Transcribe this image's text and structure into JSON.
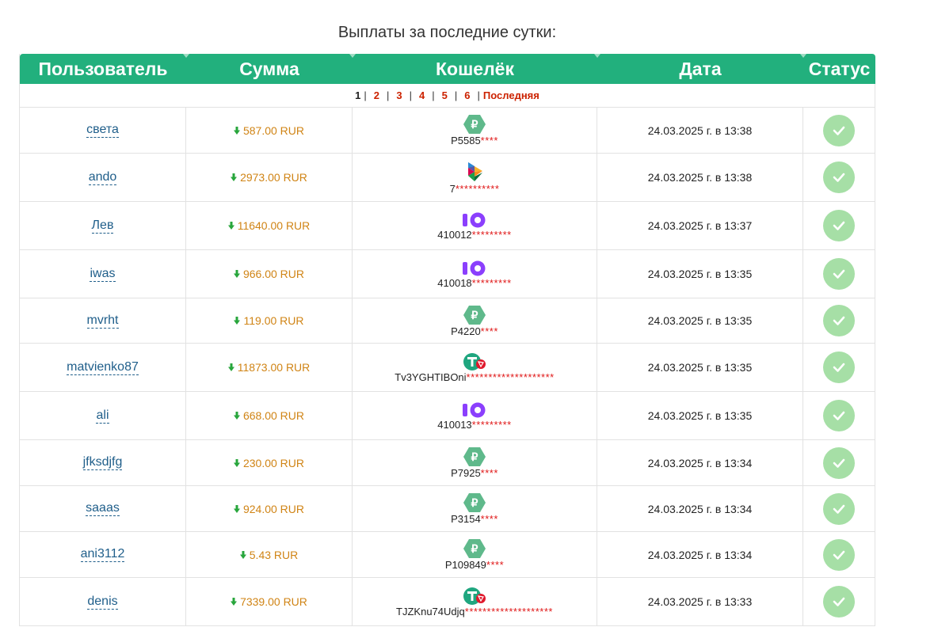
{
  "title": "Выплаты за последние сутки:",
  "headers": [
    "Пользователь",
    "Сумма",
    "Кошелёк",
    "Дата",
    "Статус"
  ],
  "pager": {
    "current": "1",
    "pages": [
      "2",
      "3",
      "4",
      "5",
      "6"
    ],
    "last": "Последняя"
  },
  "currency_colors": {
    "payeer": "#5fb98b",
    "yoomoney": "#8b3ffd",
    "usdt": "#1fa67f"
  },
  "rows": [
    {
      "user": "света",
      "amount": "587.00 RUR",
      "wallet_icon": "payeer-icon",
      "wallet_prefix": "P5585",
      "wallet_mask": "****",
      "date": "24.03.2025 г. в 13:38"
    },
    {
      "user": "ando",
      "amount": "2973.00 RUR",
      "wallet_icon": "sbp-icon",
      "wallet_prefix": "7",
      "wallet_mask": "**********",
      "date": "24.03.2025 г. в 13:38"
    },
    {
      "user": "Лев",
      "amount": "11640.00 RUR",
      "wallet_icon": "yoomoney-icon",
      "wallet_prefix": "410012",
      "wallet_mask": "*********",
      "date": "24.03.2025 г. в 13:37"
    },
    {
      "user": "iwas",
      "amount": "966.00 RUR",
      "wallet_icon": "yoomoney-icon",
      "wallet_prefix": "410018",
      "wallet_mask": "*********",
      "date": "24.03.2025 г. в 13:35"
    },
    {
      "user": "mvrht",
      "amount": "119.00 RUR",
      "wallet_icon": "payeer-icon",
      "wallet_prefix": "P4220",
      "wallet_mask": "****",
      "date": "24.03.2025 г. в 13:35"
    },
    {
      "user": "matvienko87",
      "amount": "11873.00 RUR",
      "wallet_icon": "usdt-trc20-icon",
      "wallet_prefix": "Tv3YGHTIBOni",
      "wallet_mask": "********************",
      "date": "24.03.2025 г. в 13:35"
    },
    {
      "user": "ali",
      "amount": "668.00 RUR",
      "wallet_icon": "yoomoney-icon",
      "wallet_prefix": "410013",
      "wallet_mask": "*********",
      "date": "24.03.2025 г. в 13:35"
    },
    {
      "user": "jfksdjfg",
      "amount": "230.00 RUR",
      "wallet_icon": "payeer-icon",
      "wallet_prefix": "P7925",
      "wallet_mask": "****",
      "date": "24.03.2025 г. в 13:34"
    },
    {
      "user": "saaas",
      "amount": "924.00 RUR",
      "wallet_icon": "payeer-icon",
      "wallet_prefix": "P3154",
      "wallet_mask": "****",
      "date": "24.03.2025 г. в 13:34"
    },
    {
      "user": "ani3112",
      "amount": "5.43 RUR",
      "wallet_icon": "payeer-icon",
      "wallet_prefix": "P109849",
      "wallet_mask": "****",
      "date": "24.03.2025 г. в 13:34"
    },
    {
      "user": "denis",
      "amount": "7339.00 RUR",
      "wallet_icon": "usdt-trc20-icon",
      "wallet_prefix": "TJZKnu74Udjq",
      "wallet_mask": "********************",
      "date": "24.03.2025 г. в 13:33"
    }
  ]
}
